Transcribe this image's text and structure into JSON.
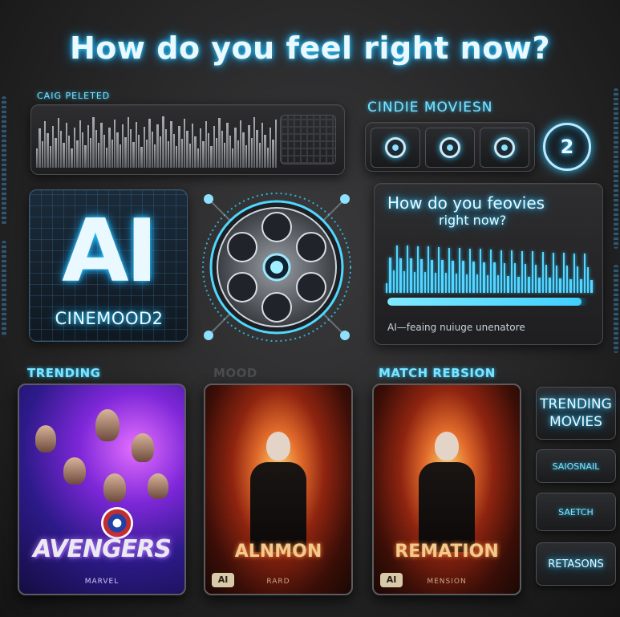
{
  "title": "How do you feel right now?",
  "status_panel": {
    "label": "CAIG PELETED"
  },
  "cinema": {
    "label": "CINDIE MOVIESN",
    "badge": "2"
  },
  "logo": {
    "mark": "AI",
    "name": "CINEMOOD2"
  },
  "feel_panel": {
    "title": "How do you feovies",
    "subtitle": "right now?",
    "progress": 0.96,
    "caption": "AI—feaing nuiuge unenatore"
  },
  "sections": {
    "trending": "TRENDING",
    "mood": "MOOD",
    "match": "MATCH REBSION"
  },
  "cards": [
    {
      "title": "AVENGERS",
      "tag": "MARVEL"
    },
    {
      "title": "ALNMON",
      "tag": "AI",
      "footer": "RARD"
    },
    {
      "title": "REMATION",
      "tag": "AI",
      "footer": "MENSION"
    }
  ],
  "side_buttons": {
    "trending": "TRENDING MOVIES",
    "save": "SAIOSNAIL",
    "watch": "SAETCH",
    "reasons": "RETASONS"
  },
  "colors": {
    "accent": "#2fd0ff",
    "background": "#262627"
  }
}
